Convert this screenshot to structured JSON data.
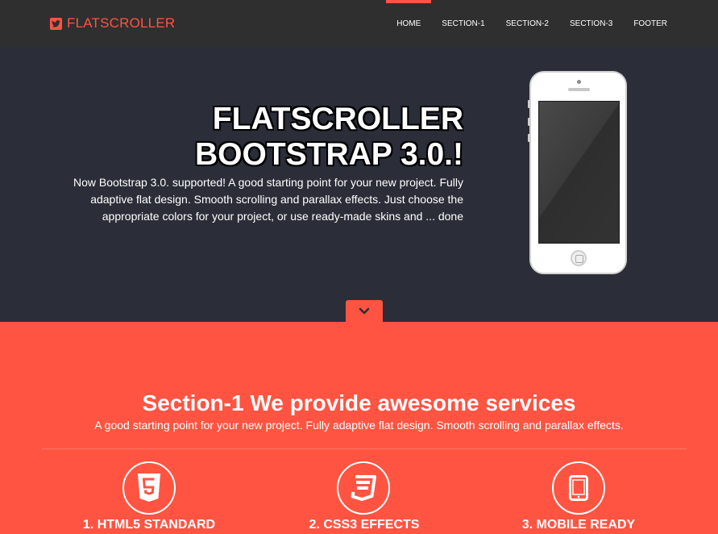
{
  "navbar": {
    "brand": "FLATSCROLLER",
    "brand_icon": "twitter-bird-icon",
    "items": [
      {
        "label": "HOME",
        "active": true
      },
      {
        "label": "SECTION-1",
        "active": false
      },
      {
        "label": "SECTION-2",
        "active": false
      },
      {
        "label": "SECTION-3",
        "active": false
      },
      {
        "label": "FOOTER",
        "active": false
      }
    ]
  },
  "hero": {
    "title_line1": "FLATSCROLLER",
    "title_line2": "BOOTSTRAP 3.0.!",
    "description": "Now Bootstrap 3.0. supported! A good starting point for your new project. Fully adaptive flat design. Smooth scrolling and parallax effects. Just choose the appropriate colors for your project, or use ready-made skins and ... done",
    "scroll_icon": "chevron-down-icon"
  },
  "section1": {
    "title": "Section-1 We provide awesome services",
    "subtitle": "A good starting point for your new project. Fully adaptive flat design. Smooth scrolling and parallax effects.",
    "features": [
      {
        "title": "1. HTML5 STANDARD",
        "icon": "html5-icon"
      },
      {
        "title": "2. CSS3 EFFECTS",
        "icon": "css3-icon"
      },
      {
        "title": "3. MOBILE READY",
        "icon": "tablet-icon"
      }
    ]
  },
  "colors": {
    "accent": "#ff5442",
    "navbar_bg": "#2f2f2f",
    "hero_bg": "#2b2e38"
  }
}
